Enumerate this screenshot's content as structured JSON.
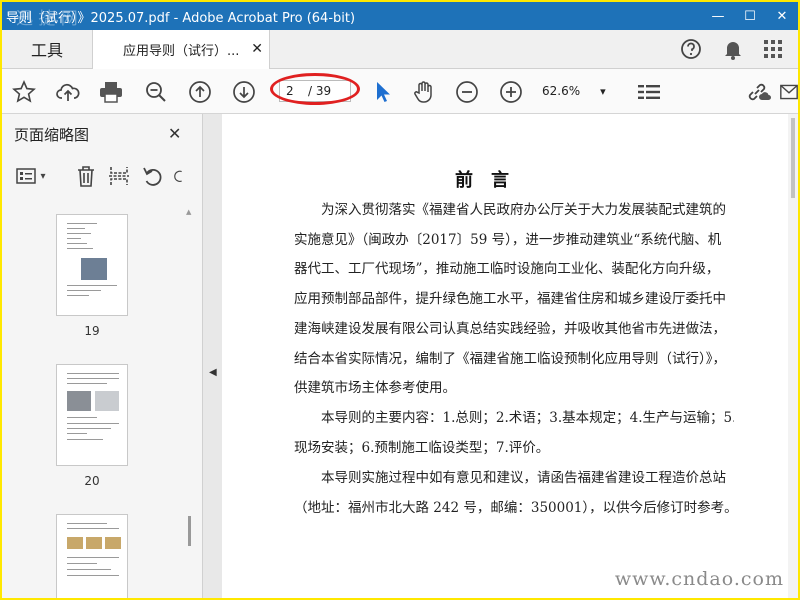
{
  "window": {
    "title": "导则（试行）》2025.07.pdf - Adobe Acrobat Pro (64-bit)",
    "watermark": "迅 捷 网",
    "buttons": [
      "—",
      "☐",
      "✕"
    ]
  },
  "tabs": {
    "tools_label": "工具",
    "document_label": "应用导则（试行）...",
    "close_glyph": "✕"
  },
  "toolbar": {
    "current_page": "2",
    "total_pages": "/ 39",
    "zoom": "62.6%",
    "zoom_caret": "▾"
  },
  "sidebar": {
    "title": "页面缩略图",
    "close_glyph": "✕",
    "options_caret": "▾",
    "thumbnails": [
      {
        "page": "19"
      },
      {
        "page": "20"
      },
      {
        "page": ""
      }
    ]
  },
  "document": {
    "heading": "前　言",
    "paragraphs": [
      [
        "　　为深入贯彻落实《福建省人民政府办公厅关于大力发展装配式建筑的",
        "实施意见》（闽政办〔2017〕59 号），进一步推动建筑业“系统代脑、机",
        "器代工、工厂代现场”，推动施工临时设施向工业化、装配化方向升级，",
        "应用预制部品部件，提升绿色施工水平，福建省住房和城乡建设厅委托中",
        "建海峡建设发展有限公司认真总结实践经验，并吸收其他省市先进做法，",
        "结合本省实际情况，编制了《福建省施工临设预制化应用导则（试行）》，",
        "供建筑市场主体参考使用。"
      ],
      [
        "　　本导则的主要内容：1.总则；2.术语；3.基本规定；4.生产与运输；5.",
        "现场安装；6.预制施工临设类型；7.评价。"
      ],
      [
        "　　本导则实施过程中如有意见和建议，请函告福建省建设工程造价总站",
        "（地址：福州市北大路 242 号，邮编：350001），以供今后修订时参考。"
      ]
    ],
    "watermark": "www.cndao.com"
  },
  "colors": {
    "titlebar": "#1e72b8",
    "highlight_oval": "#e02020",
    "cursor_blue": "#1e6fd0",
    "frame": "#ffe800"
  }
}
